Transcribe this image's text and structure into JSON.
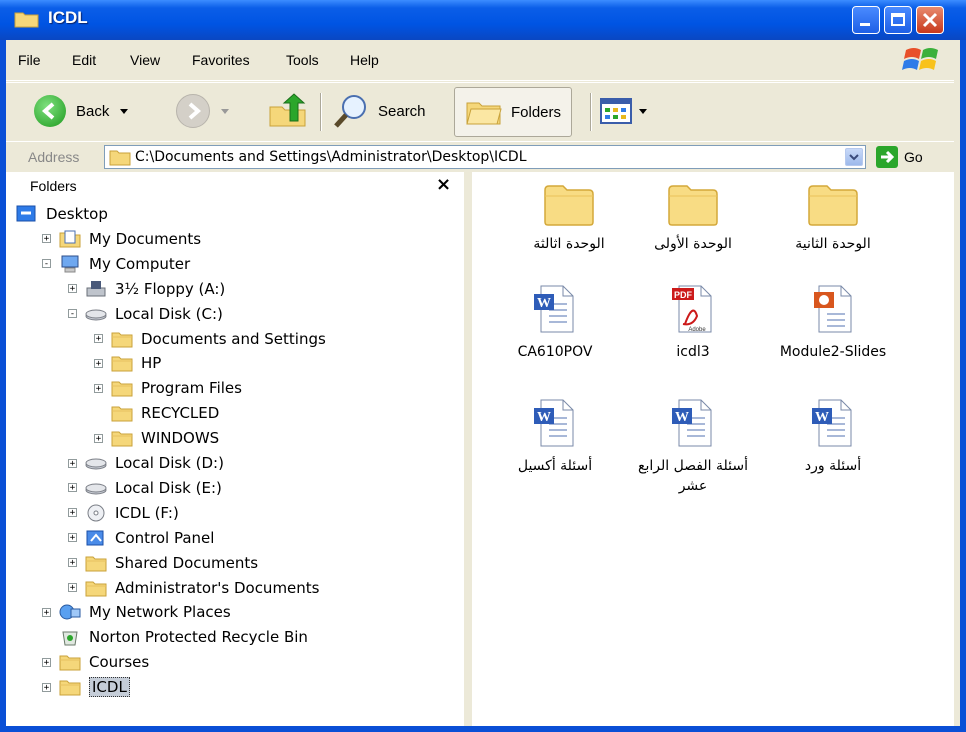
{
  "window": {
    "title": "ICDL"
  },
  "menu": [
    "File",
    "Edit",
    "View",
    "Favorites",
    "Tools",
    "Help"
  ],
  "toolbar": {
    "back": "Back",
    "search": "Search",
    "folders": "Folders"
  },
  "address": {
    "label": "Address",
    "path": "C:\\Documents and Settings\\Administrator\\Desktop\\ICDL",
    "go": "Go"
  },
  "folders_pane": {
    "title": "Folders",
    "nodes": [
      "Desktop",
      "My Documents",
      "My Computer",
      "3½ Floppy (A:)",
      "Local Disk (C:)",
      "Documents and Settings",
      "HP",
      "Program Files",
      "RECYCLED",
      "WINDOWS",
      "Local Disk (D:)",
      "Local Disk (E:)",
      "ICDL (F:)",
      "Control Panel",
      "Shared Documents",
      "Administrator's Documents",
      "My Network Places",
      "Norton Protected Recycle Bin",
      "Courses",
      "ICDL"
    ]
  },
  "items": [
    {
      "name": "الوحدة اثالثة",
      "type": "folder"
    },
    {
      "name": "الوحدة الأولى",
      "type": "folder"
    },
    {
      "name": "الوحدة الثانية",
      "type": "folder"
    },
    {
      "name": "CA610POV",
      "type": "word"
    },
    {
      "name": "icdl3",
      "type": "pdf"
    },
    {
      "name": "Module2-Slides",
      "type": "powerpoint"
    },
    {
      "name": "أسئلة أكسيل",
      "type": "word"
    },
    {
      "name": "أسئلة الفصل الرابع عشر",
      "type": "word"
    },
    {
      "name": "أسئلة ورد",
      "type": "word"
    }
  ]
}
